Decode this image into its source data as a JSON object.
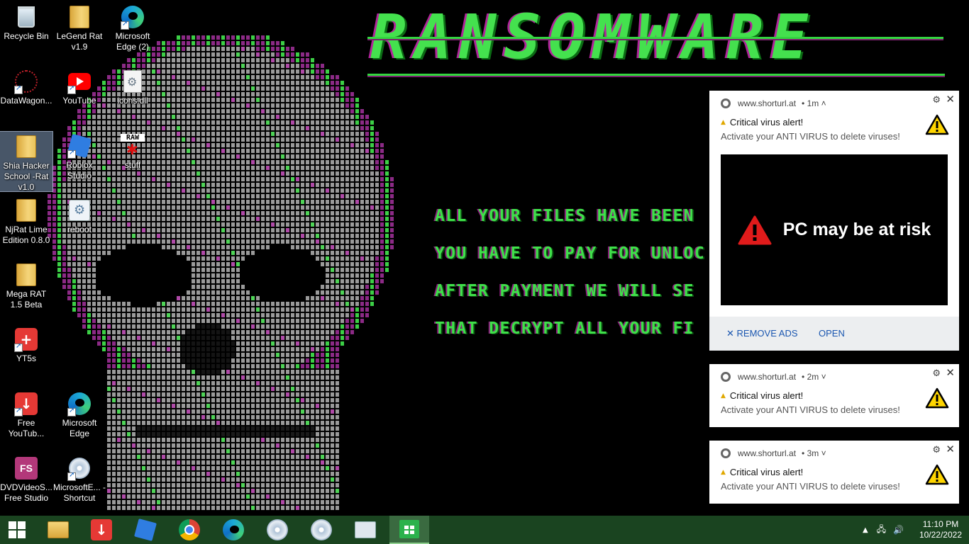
{
  "wallpaper": {
    "title": "RANSOMWARE",
    "lines": [
      "ALL YOUR FILES HAVE BEEN",
      "YOU HAVE TO PAY FOR UNLOC",
      "AFTER PAYMENT WE WILL SE",
      "THAT DECRYPT ALL YOUR FI"
    ]
  },
  "desktop": {
    "icons": [
      {
        "label": "Recycle Bin",
        "icon": "recycle-bin-icon"
      },
      {
        "label": "LeGend Rat v1.9",
        "icon": "folder-icon"
      },
      {
        "label": "Microsoft Edge (2)",
        "icon": "edge-icon"
      },
      {
        "label": "DataWagon...",
        "icon": "datawagon-icon"
      },
      {
        "label": "YouTube",
        "icon": "youtube-icon"
      },
      {
        "label": "icons.dll",
        "icon": "dll-file-icon"
      },
      {
        "label": "Shia Hacker School -Rat v1.0",
        "icon": "folder-icon"
      },
      {
        "label": "Roblox Studio",
        "icon": "roblox-studio-icon"
      },
      {
        "label": "stuff",
        "icon": "raw-file-icon"
      },
      {
        "label": "NjRat Lime Edition 0.8.0",
        "icon": "folder-icon"
      },
      {
        "label": "reboot",
        "icon": "reboot-icon"
      },
      {
        "label": "Mega RAT 1.5 Beta",
        "icon": "folder-icon"
      },
      {
        "label": "YT5s",
        "icon": "yt5s-icon"
      },
      {
        "label": "Free YouTub...",
        "icon": "free-youtube-icon"
      },
      {
        "label": "Microsoft Edge",
        "icon": "edge-icon"
      },
      {
        "label": "DVDVideoS... Free Studio",
        "icon": "dvdvideosoft-icon"
      },
      {
        "label": "MicrosoftE... - Shortcut",
        "icon": "disc-shortcut-icon"
      }
    ]
  },
  "notifications": [
    {
      "source": "www.shorturl.at",
      "time": "• 1m ˄",
      "title": "Critical virus alert!",
      "body": "Activate your ANTI VIRUS to delete viruses!",
      "image_text": "PC may be at risk",
      "actions": {
        "remove_ads": "REMOVE ADS",
        "open": "OPEN"
      }
    },
    {
      "source": "www.shorturl.at",
      "time": "• 2m ˅",
      "title": "Critical virus alert!",
      "body": "Activate your ANTI VIRUS to delete viruses!"
    },
    {
      "source": "www.shorturl.at",
      "time": "• 3m ˅",
      "title": "Critical virus alert!",
      "body": "Activate your ANTI VIRUS to delete viruses!"
    }
  ],
  "taskbar": {
    "apps": [
      "start-icon",
      "file-explorer-icon",
      "downloader-icon",
      "roblox-icon",
      "chrome-icon",
      "edge-icon",
      "disc-app-icon",
      "disc-app-2-icon",
      "control-panel-icon",
      "microsoft-store-icon"
    ],
    "clock": {
      "time": "11:10 PM",
      "date": "10/22/2022"
    }
  },
  "colors": {
    "wallpaper_green": "#3fe04a",
    "taskbar": "#1a4420",
    "link_blue": "#1a56b0"
  }
}
